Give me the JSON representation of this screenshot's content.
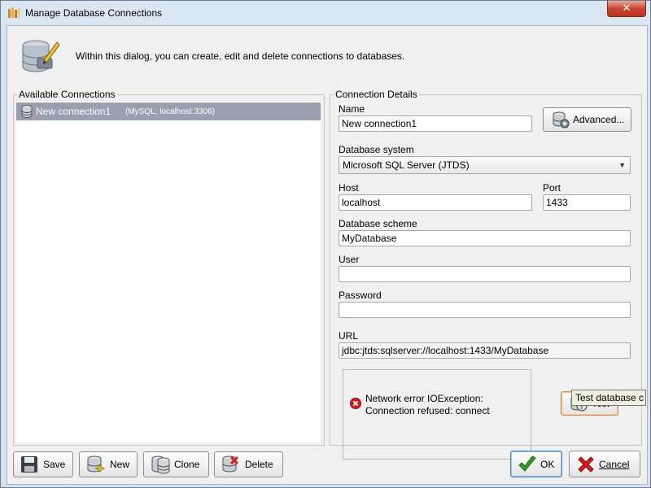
{
  "window": {
    "title": "Manage Database Connections",
    "close_glyph": "✕"
  },
  "header": {
    "text": "Within this dialog, you can create, edit and delete connections to databases.",
    "icon": "database-edit-icon"
  },
  "connections": {
    "legend": "Available Connections",
    "items": [
      {
        "name": "New connection1",
        "detail": "(MySQL; localhost:3306)"
      }
    ]
  },
  "details": {
    "legend": "Connection Details",
    "name_label": "Name",
    "name_value": "New connection1",
    "advanced_label": "Advanced...",
    "dbsystem_label": "Database system",
    "dbsystem_value": "Microsoft SQL Server (JTDS)",
    "host_label": "Host",
    "host_value": "localhost",
    "port_label": "Port",
    "port_value": "1433",
    "scheme_label": "Database scheme",
    "scheme_value": "MyDatabase",
    "user_label": "User",
    "user_value": "",
    "password_label": "Password",
    "password_value": "",
    "url_label": "URL",
    "url_value": "jdbc:jtds:sqlserver://localhost:1433/MyDatabase",
    "error_line1": "Network error IOException:",
    "error_line2": "Connection refused: connect",
    "test_label": "Test",
    "tooltip": "Test database c"
  },
  "buttons": {
    "save": "Save",
    "new": "New",
    "clone": "Clone",
    "delete": "Delete",
    "ok": "OK",
    "cancel": "Cancel"
  },
  "colors": {
    "selection": "#9a9fb0",
    "error": "#cc2222",
    "ok_check": "#2f9e22",
    "cancel_x": "#cc1f1f"
  }
}
